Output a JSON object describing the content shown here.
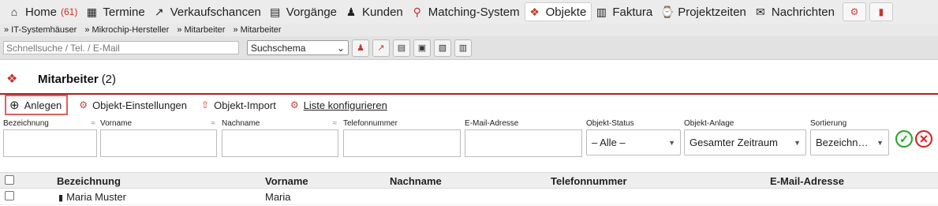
{
  "nav": {
    "items": [
      {
        "icon": "home-icon",
        "glyph": "⌂",
        "label": "Home",
        "count": "(61)"
      },
      {
        "icon": "calendar-icon",
        "glyph": "▦",
        "label": "Termine"
      },
      {
        "icon": "chart-icon",
        "glyph": "↗",
        "label": "Verkaufschancen"
      },
      {
        "icon": "clipboard-icon",
        "glyph": "▤",
        "label": "Vorgänge"
      },
      {
        "icon": "people-icon",
        "glyph": "♟",
        "label": "Kunden"
      },
      {
        "icon": "magnifier-icon",
        "glyph": "⚲",
        "label": "Matching-System"
      },
      {
        "icon": "objects-icon",
        "glyph": "❖",
        "label": "Objekte",
        "active": true
      },
      {
        "icon": "invoice-icon",
        "glyph": "▥",
        "label": "Faktura"
      },
      {
        "icon": "stopwatch-icon",
        "glyph": "⌚",
        "label": "Projektzeiten"
      },
      {
        "icon": "envelope-icon",
        "glyph": "✉",
        "label": "Nachrichten"
      }
    ],
    "extra_buttons": [
      {
        "icon": "gears-icon",
        "glyph": "⚙"
      },
      {
        "icon": "bar-chart-icon",
        "glyph": "▮"
      }
    ]
  },
  "breadcrumb": [
    "» IT-Systemhäuser",
    "» Mikrochip-Hersteller",
    "» Mitarbeiter",
    "» Mitarbeiter"
  ],
  "search": {
    "placeholder": "Schnellsuche / Tel. / E-Mail",
    "schema_label": "Suchschema",
    "schema_caret": "⌄",
    "toolbar": [
      {
        "icon": "people-icon",
        "glyph": "♟"
      },
      {
        "icon": "line-chart-icon",
        "glyph": "↗"
      },
      {
        "icon": "clipboard-icon",
        "glyph": "▤"
      },
      {
        "icon": "briefcase-icon",
        "glyph": "▣"
      },
      {
        "icon": "document-icon",
        "glyph": "▧"
      },
      {
        "icon": "invoice-icon",
        "glyph": "▥"
      }
    ]
  },
  "page": {
    "title_icon": "❖",
    "title": "Mitarbeiter",
    "count": "(2)"
  },
  "actions": {
    "add": {
      "glyph": "⊕",
      "label": "Anlegen"
    },
    "settings": {
      "glyph": "⚙",
      "label": "Objekt-Einstellungen"
    },
    "import": {
      "glyph": "⇧",
      "label": "Objekt-Import"
    },
    "configure": {
      "glyph": "⚙",
      "label": "Liste konfigurieren"
    }
  },
  "filters": {
    "approx": "≈",
    "bezeichnung": "Bezeichnung",
    "vorname": "Vorname",
    "nachname": "Nachname",
    "telefon": "Telefonnummer",
    "email": "E-Mail-Adresse",
    "status": {
      "label": "Objekt-Status",
      "value": "– Alle –"
    },
    "anlage": {
      "label": "Objekt-Anlage",
      "value": "Gesamter Zeitraum"
    },
    "sortierung": {
      "label": "Sortierung",
      "value": "Bezeichn…"
    },
    "caret": "▼",
    "apply_glyph": "✓",
    "reset_glyph": "✕"
  },
  "table": {
    "columns": [
      "Bezeichnung",
      "Vorname",
      "Nachname",
      "Telefonnummer",
      "E-Mail-Adresse"
    ],
    "rows": [
      {
        "bezeichnung": "Maria Muster",
        "vorname": "Maria",
        "nachname": "",
        "telefon": "",
        "email": "",
        "icon_glyph": "▮"
      }
    ]
  },
  "colors": {
    "accent_red": "#b02020",
    "nav_bg": "#ececec",
    "count_red": "#d03020",
    "apply_green": "#2ea02e"
  }
}
